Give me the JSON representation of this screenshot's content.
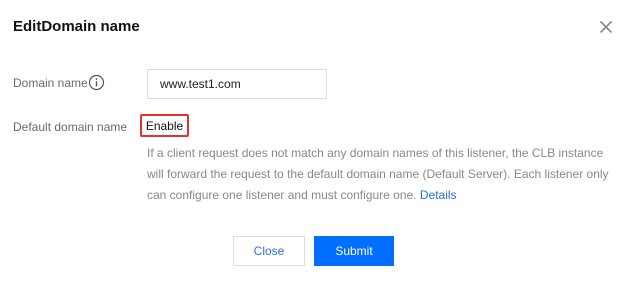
{
  "dialog": {
    "title": "EditDomain name",
    "close_icon": "close-icon"
  },
  "form": {
    "domain_label": "Domain name",
    "domain_info_icon": "info-circle-icon",
    "domain_value": "www.test1.com",
    "default_label": "Default domain name",
    "default_option": "Enable",
    "description": "If a client request does not match any domain names of this listener, the CLB instance will forward the request to the default domain name (Default Server). Each listener only can configure one listener and must configure one.",
    "details_link": "Details"
  },
  "footer": {
    "close_label": "Close",
    "submit_label": "Submit"
  },
  "colors": {
    "accent": "#006eff",
    "link": "#2a6fdb",
    "highlight_border": "#e5322d"
  }
}
